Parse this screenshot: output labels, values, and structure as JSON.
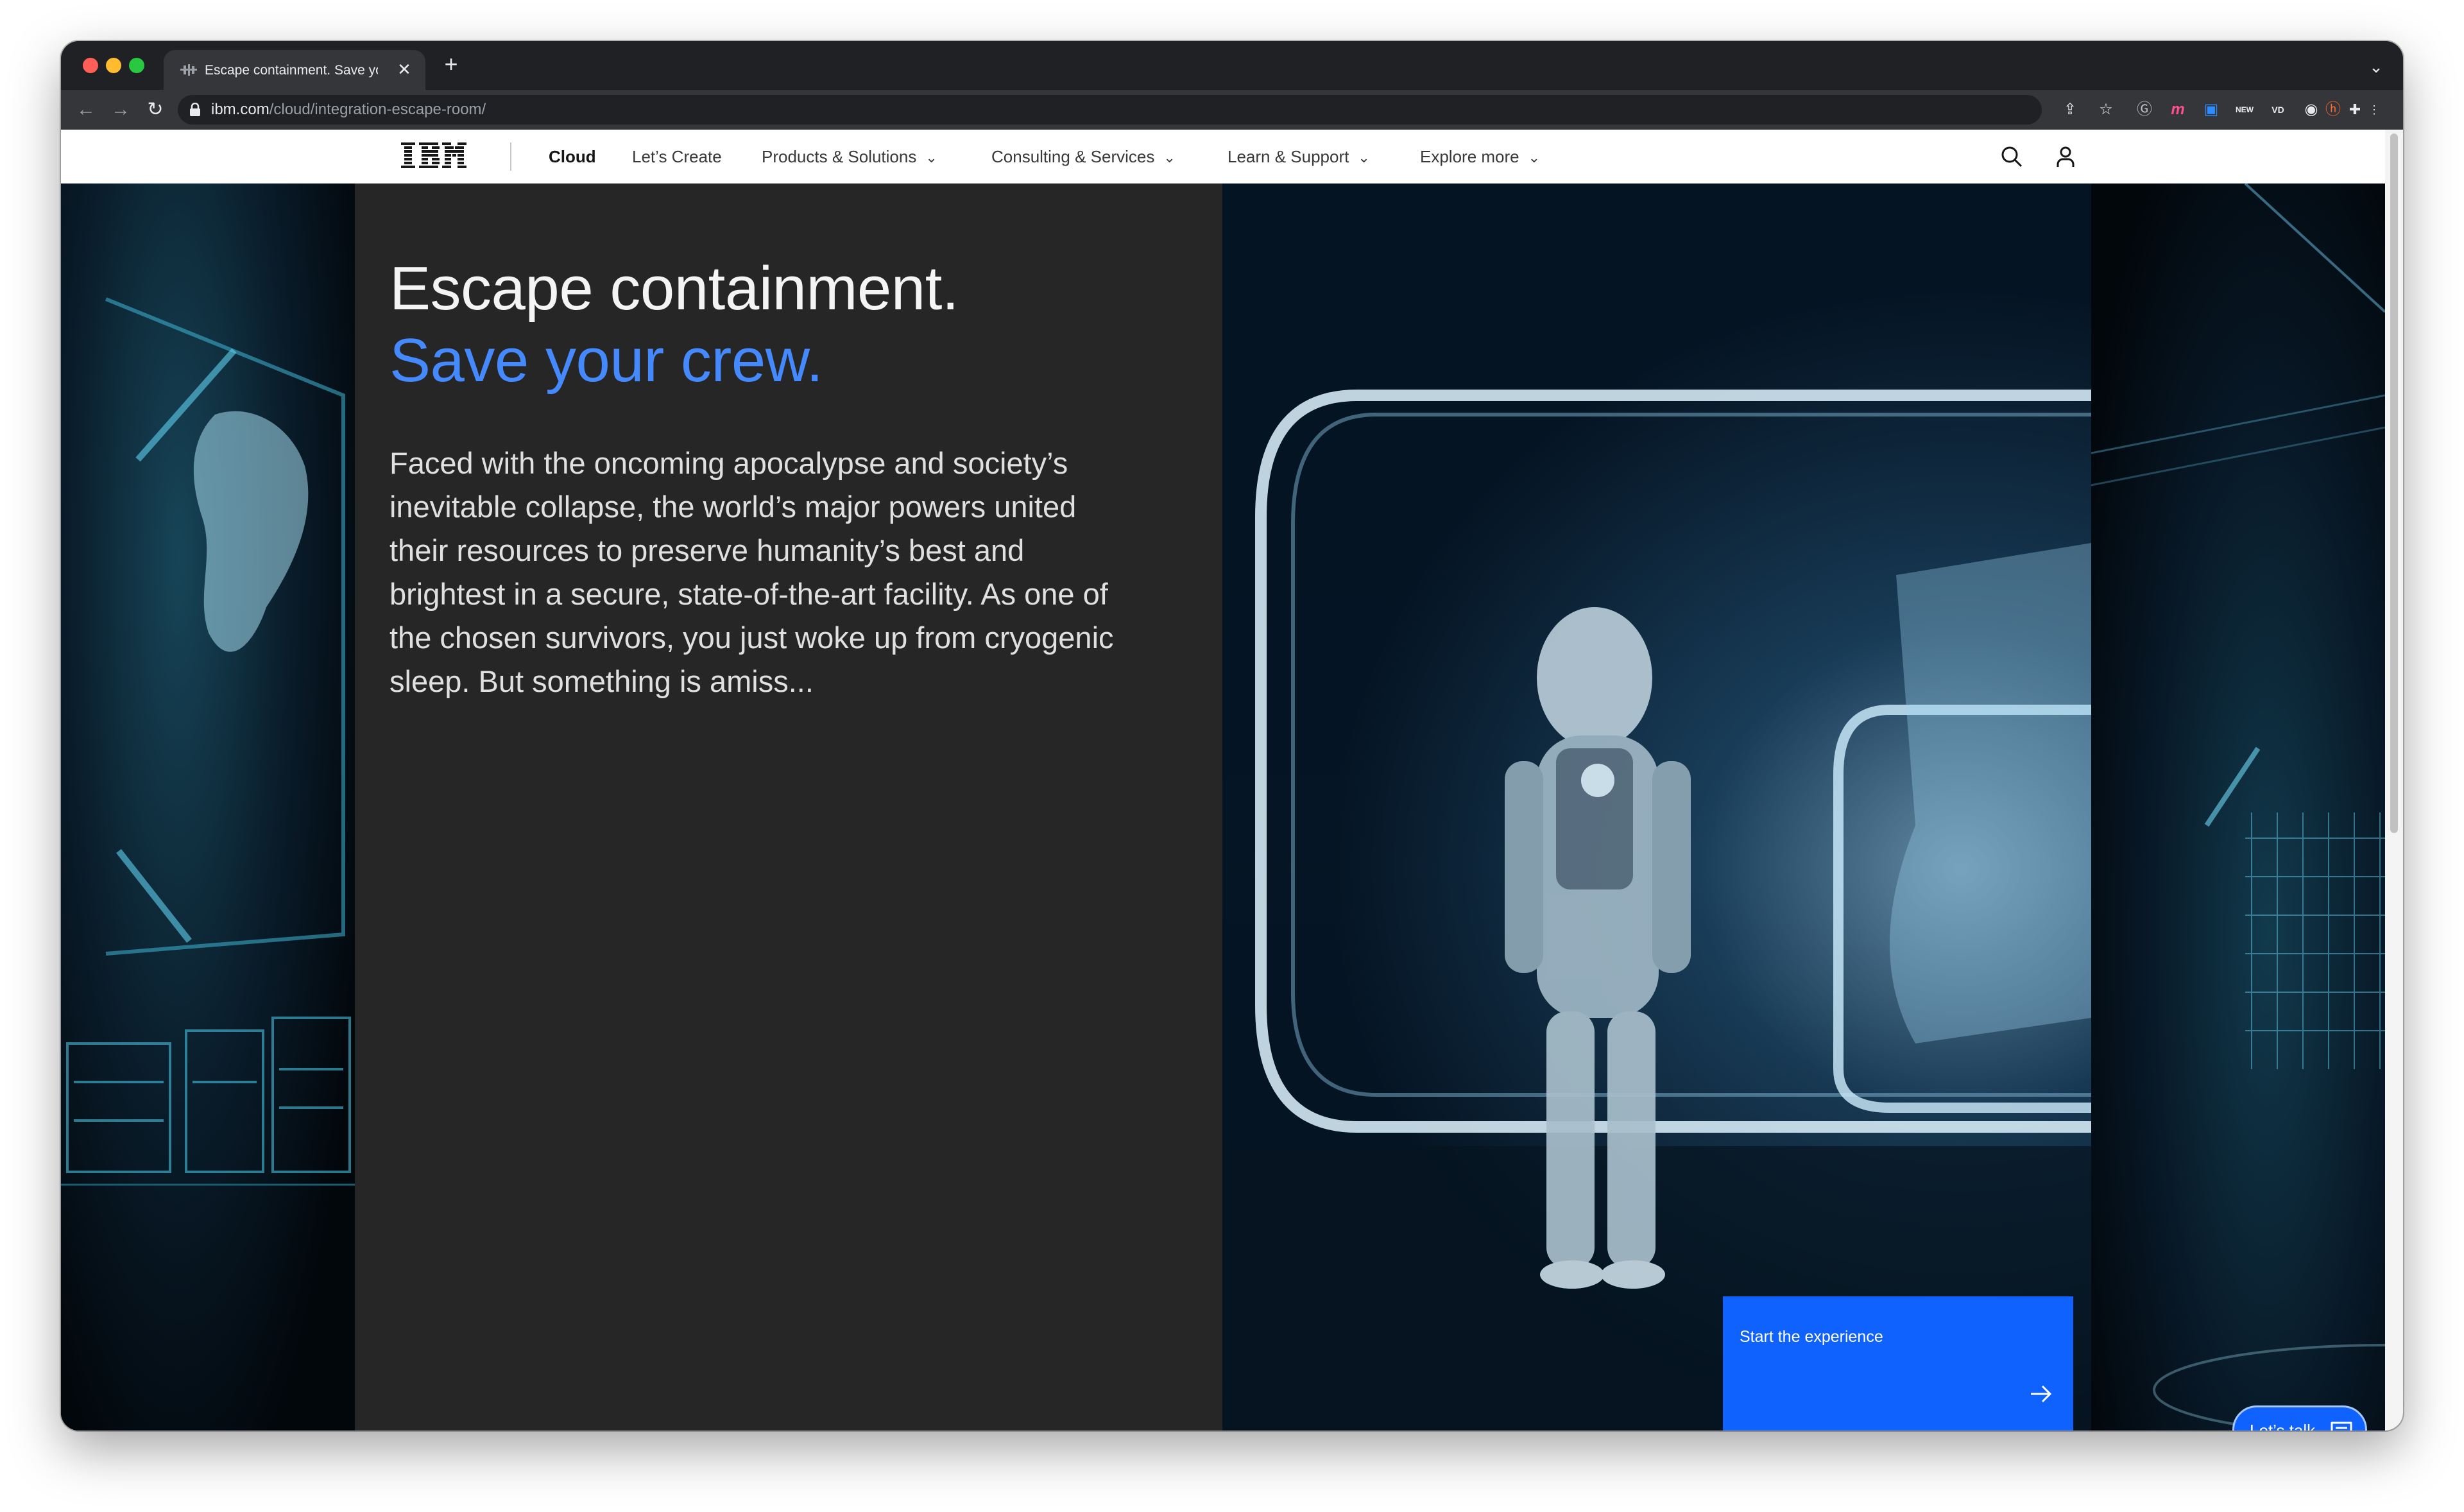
{
  "browser": {
    "tab": {
      "title": "Escape containment. Save your crew.",
      "favicon": "ibm-favicon-icon",
      "close_glyph": "✕"
    },
    "new_tab_glyph": "+",
    "tab_menu_glyph": "⌄",
    "nav": {
      "back": "←",
      "forward": "→",
      "reload": "↻"
    },
    "address": {
      "host": "ibm.com",
      "path": "/cloud/integration-escape-room/"
    },
    "toolbar_icons": [
      "share-icon",
      "bookmark-star-icon",
      "extension-g-icon",
      "extension-m-icon",
      "zoom-icon",
      "new-extension-icon",
      "vd-extension-icon",
      "eye-extension-icon",
      "honey-extension-icon",
      "puzzle-extensions-icon",
      "sidebar-icon",
      "profile-avatar-icon",
      "kebab-menu-icon"
    ],
    "toolbar_glyphs": {
      "share": "⇪",
      "star": "☆",
      "g": "Ⓖ",
      "m": "m",
      "zoom": "▣",
      "new": "NEW",
      "vd": "VD",
      "eye": "◉",
      "honey": "ⓗ",
      "puzzle": "✚",
      "sidebar": "▮",
      "profile": "●",
      "kebab": "⋮"
    }
  },
  "masthead": {
    "logo_alt": "IBM",
    "links": [
      {
        "label": "Cloud",
        "dropdown": false,
        "active": true
      },
      {
        "label": "Let’s Create",
        "dropdown": false,
        "active": false
      },
      {
        "label": "Products & Solutions",
        "dropdown": true,
        "active": false
      },
      {
        "label": "Consulting & Services",
        "dropdown": true,
        "active": false
      },
      {
        "label": "Learn & Support",
        "dropdown": true,
        "active": false
      },
      {
        "label": "Explore more",
        "dropdown": true,
        "active": false
      }
    ],
    "chevron_glyph": "⌄"
  },
  "hero": {
    "title_line1": "Escape containment.",
    "title_line2": "Save your crew.",
    "body": "Faced with the oncoming apocalypse and society’s inevitable collapse, the world’s major powers united their resources to preserve humanity’s best and brightest in a secure, state-of-the-art facility. As one of the chosen survivors, you just woke up from cryogenic sleep. But something is amiss...",
    "accent_color": "#4589ff",
    "cta": {
      "label": "Start the experience",
      "color": "#0f62fe"
    }
  },
  "chat": {
    "label": "Let’s talk"
  }
}
